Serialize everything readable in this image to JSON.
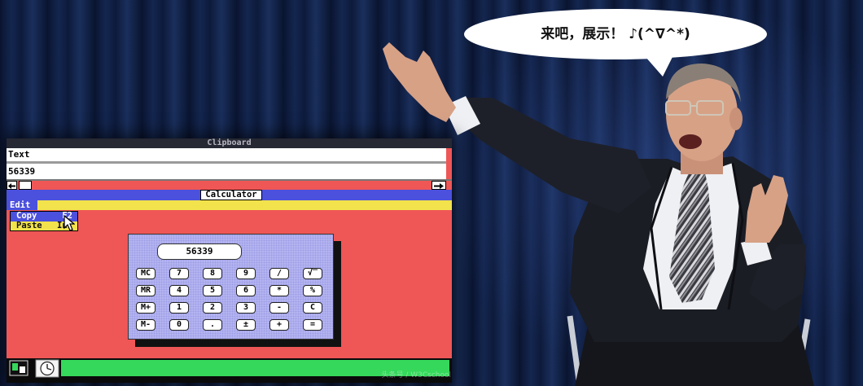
{
  "speech_bubble": {
    "text": "来吧，展示！ ♪(^∇^*)"
  },
  "clipboard": {
    "title": "Clipboard",
    "format": "Text",
    "content": "56339"
  },
  "calculator": {
    "title": "Calculator",
    "menu_label": "Edit",
    "menu_items": [
      {
        "label": "Copy",
        "shortcut": "F2"
      },
      {
        "label": "Paste",
        "shortcut": "Ins"
      }
    ],
    "display": "56339",
    "buttons": [
      [
        "MC",
        "7",
        "8",
        "9",
        "/",
        "√‾"
      ],
      [
        "MR",
        "4",
        "5",
        "6",
        "*",
        "%"
      ],
      [
        "M+",
        "1",
        "2",
        "3",
        "-",
        "C"
      ],
      [
        "M-",
        "0",
        ".",
        "±",
        "+",
        "="
      ]
    ]
  },
  "taskbar": {
    "icons": [
      "program-icon",
      "clock-icon"
    ]
  },
  "watermark": "头条号 / W3Cschool",
  "colors": {
    "red": "#ef5656",
    "blue": "#4b50dd",
    "yellow": "#f2e24c",
    "green": "#35d85b",
    "lavender": "#b8b8f4"
  }
}
